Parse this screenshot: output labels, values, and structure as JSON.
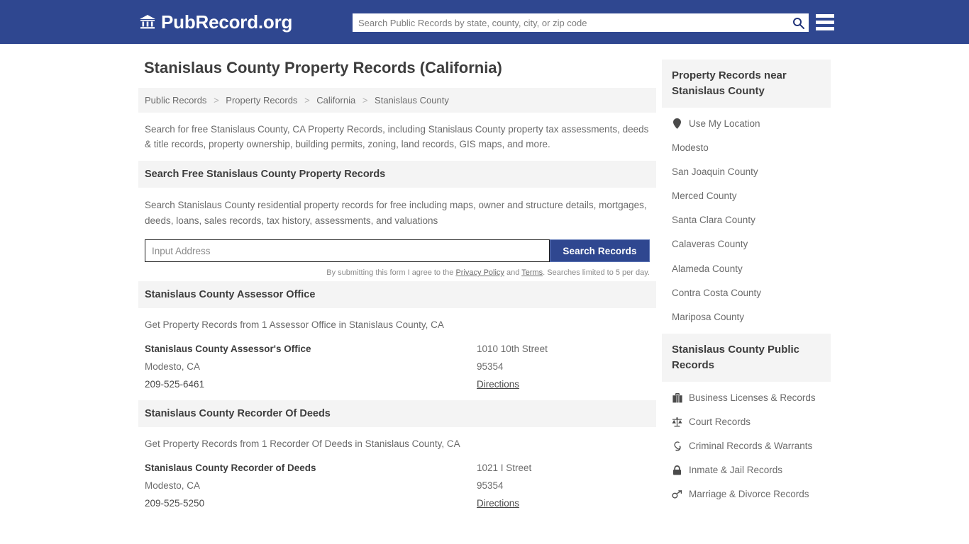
{
  "header": {
    "brand_text": "PubRecord.org",
    "brand_icon": "bank-building-icon",
    "search_placeholder": "Search Public Records by state, county, city, or zip code",
    "search_value": "",
    "search_icon": "search-icon",
    "menu_icon": "hamburger-menu-icon",
    "bg_color": "#2f4790"
  },
  "main": {
    "page_title": "Stanislaus County Property Records (California)",
    "breadcrumb": [
      "Public Records",
      "Property Records",
      "California",
      "Stanislaus County"
    ],
    "breadcrumb_separator": ">",
    "intro": "Search for free Stanislaus County, CA Property Records, including Stanislaus County property tax assessments, deeds & title records, property ownership, building permits, zoning, land records, GIS maps, and more.",
    "search_section": {
      "heading": "Search Free Stanislaus County Property Records",
      "description": "Search Stanislaus County residential property records for free including maps, owner and structure details, mortgages, deeds, loans, sales records, tax history, assessments, and valuations",
      "input_placeholder": "Input Address",
      "input_value": "",
      "button_label": "Search Records",
      "button_color": "#2f4790",
      "disclaimer_prefix": "By submitting this form I agree to the ",
      "disclaimer_privacy": "Privacy Policy",
      "disclaimer_and": " and ",
      "disclaimer_terms": "Terms",
      "disclaimer_suffix": ". Searches limited to 5 per day."
    },
    "sections": [
      {
        "heading": "Stanislaus County Assessor Office",
        "description": "Get Property Records from 1 Assessor Office in Stanislaus County, CA",
        "offices": [
          {
            "name": "Stanislaus County Assessor's Office",
            "city_state": "Modesto, CA",
            "phone": "209-525-6461",
            "street": "1010 10th Street",
            "zip": "95354",
            "directions_label": "Directions"
          }
        ]
      },
      {
        "heading": "Stanislaus County Recorder Of Deeds",
        "description": "Get Property Records from 1 Recorder Of Deeds in Stanislaus County, CA",
        "offices": [
          {
            "name": "Stanislaus County Recorder of Deeds",
            "city_state": "Modesto, CA",
            "phone": "209-525-5250",
            "street": "1021 I Street",
            "zip": "95354",
            "directions_label": "Directions"
          }
        ]
      }
    ]
  },
  "sidebar": {
    "nearby": {
      "heading": "Property Records near Stanislaus County",
      "items": [
        {
          "label": "Use My Location",
          "icon": "map-pin-icon"
        },
        {
          "label": "Modesto",
          "icon": ""
        },
        {
          "label": "San Joaquin County",
          "icon": ""
        },
        {
          "label": "Merced County",
          "icon": ""
        },
        {
          "label": "Santa Clara County",
          "icon": ""
        },
        {
          "label": "Calaveras County",
          "icon": ""
        },
        {
          "label": "Alameda County",
          "icon": ""
        },
        {
          "label": "Contra Costa County",
          "icon": ""
        },
        {
          "label": "Mariposa County",
          "icon": ""
        }
      ]
    },
    "public_records": {
      "heading": "Stanislaus County Public Records",
      "items": [
        {
          "label": "Business Licenses & Records",
          "icon": "briefcase-icon"
        },
        {
          "label": "Court Records",
          "icon": "scales-of-justice-icon"
        },
        {
          "label": "Criminal Records & Warrants",
          "icon": "fingerprint-icon"
        },
        {
          "label": "Inmate & Jail Records",
          "icon": "lock-icon"
        },
        {
          "label": "Marriage & Divorce Records",
          "icon": "gender-symbols-icon"
        }
      ]
    }
  }
}
